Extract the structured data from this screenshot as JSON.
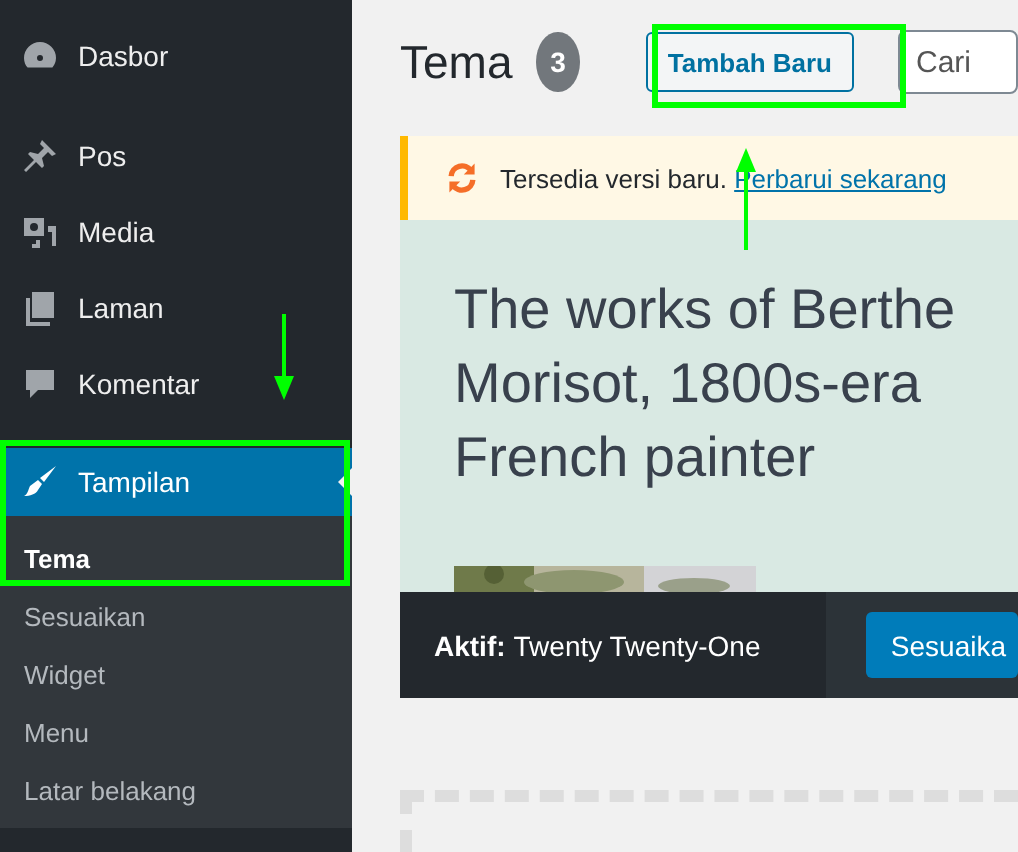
{
  "sidebar": {
    "items": [
      {
        "label": "Dasbor",
        "selected": false
      },
      {
        "label": "Pos",
        "selected": false
      },
      {
        "label": "Media",
        "selected": false
      },
      {
        "label": "Laman",
        "selected": false
      },
      {
        "label": "Komentar",
        "selected": false
      },
      {
        "label": "Tampilan",
        "selected": true,
        "children": [
          {
            "label": "Tema",
            "selected": true
          },
          {
            "label": "Sesuaikan",
            "selected": false
          },
          {
            "label": "Widget",
            "selected": false
          },
          {
            "label": "Menu",
            "selected": false
          },
          {
            "label": "Latar belakang",
            "selected": false
          }
        ]
      }
    ]
  },
  "header": {
    "title": "Tema",
    "count": "3",
    "add_button": "Tambah Baru",
    "search": {
      "placeholder": "Cari"
    }
  },
  "notice": {
    "text": "Tersedia versi baru.",
    "link": "Perbarui sekarang"
  },
  "active_theme": {
    "preview_lines": [
      "The works of Berthe",
      "Morisot, 1800s-era",
      "French painter"
    ],
    "label": "Aktif:",
    "name": "Twenty Twenty-One",
    "button": "Sesuaika"
  }
}
